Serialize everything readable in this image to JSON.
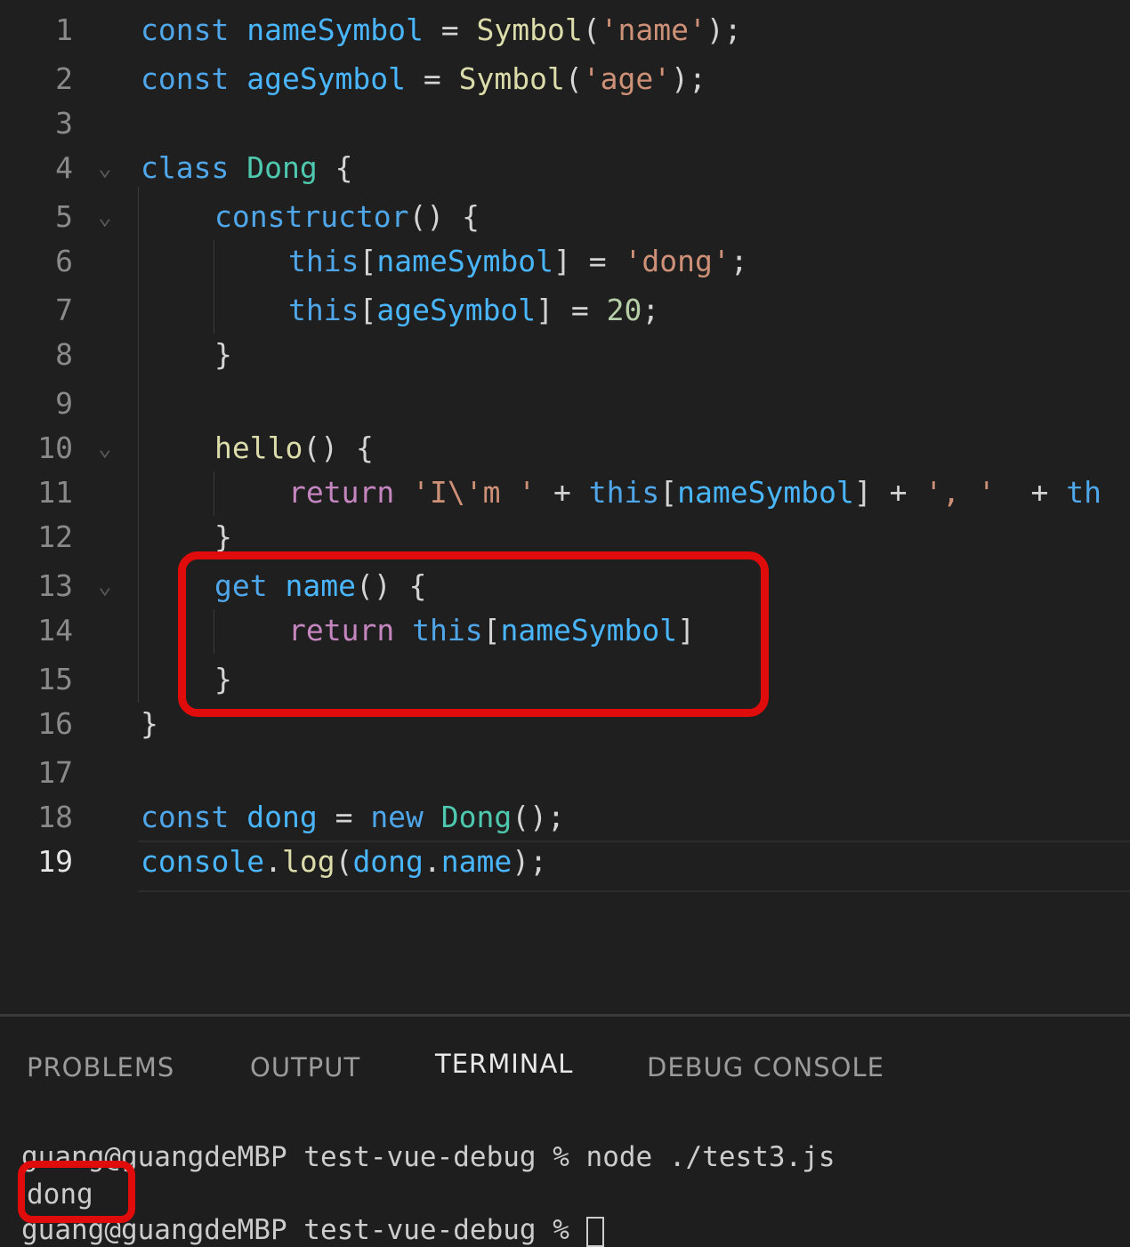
{
  "editor": {
    "lines": [
      {
        "n": "1",
        "indent": 0,
        "tokens": [
          [
            "k",
            "const"
          ],
          [
            "p",
            " "
          ],
          [
            "v",
            "nameSymbol"
          ],
          [
            "p",
            " = "
          ],
          [
            "f",
            "Symbol"
          ],
          [
            "p",
            "("
          ],
          [
            "s",
            "'name'"
          ],
          [
            "p",
            ");"
          ]
        ]
      },
      {
        "n": "2",
        "indent": 0,
        "tokens": [
          [
            "k",
            "const"
          ],
          [
            "p",
            " "
          ],
          [
            "v",
            "ageSymbol"
          ],
          [
            "p",
            " = "
          ],
          [
            "f",
            "Symbol"
          ],
          [
            "p",
            "("
          ],
          [
            "s",
            "'age'"
          ],
          [
            "p",
            ");"
          ]
        ]
      },
      {
        "n": "3",
        "indent": 0,
        "tokens": []
      },
      {
        "n": "4",
        "indent": 0,
        "fold": true,
        "tokens": [
          [
            "k",
            "class"
          ],
          [
            "p",
            " "
          ],
          [
            "c",
            "Dong"
          ],
          [
            "p",
            " {"
          ]
        ]
      },
      {
        "n": "5",
        "indent": 1,
        "fold": true,
        "tokens": [
          [
            "k",
            "constructor"
          ],
          [
            "p",
            "() {"
          ]
        ]
      },
      {
        "n": "6",
        "indent": 2,
        "tokens": [
          [
            "k",
            "this"
          ],
          [
            "p",
            "["
          ],
          [
            "v",
            "nameSymbol"
          ],
          [
            "p",
            "] = "
          ],
          [
            "s",
            "'dong'"
          ],
          [
            "p",
            ";"
          ]
        ]
      },
      {
        "n": "7",
        "indent": 2,
        "tokens": [
          [
            "k",
            "this"
          ],
          [
            "p",
            "["
          ],
          [
            "v",
            "ageSymbol"
          ],
          [
            "p",
            "] = "
          ],
          [
            "n",
            "20"
          ],
          [
            "p",
            ";"
          ]
        ]
      },
      {
        "n": "8",
        "indent": 1,
        "tokens": [
          [
            "p",
            "}"
          ]
        ]
      },
      {
        "n": "9",
        "indent": 0,
        "tokens": []
      },
      {
        "n": "10",
        "indent": 1,
        "fold": true,
        "tokens": [
          [
            "f",
            "hello"
          ],
          [
            "p",
            "() {"
          ]
        ]
      },
      {
        "n": "11",
        "indent": 2,
        "tokens": [
          [
            "r",
            "return"
          ],
          [
            "p",
            " "
          ],
          [
            "s",
            "'I\\'m '"
          ],
          [
            "p",
            " + "
          ],
          [
            "k",
            "this"
          ],
          [
            "p",
            "["
          ],
          [
            "v",
            "nameSymbol"
          ],
          [
            "p",
            "] + "
          ],
          [
            "s",
            "', '"
          ],
          [
            "p",
            "  + "
          ],
          [
            "k",
            "th"
          ]
        ]
      },
      {
        "n": "12",
        "indent": 1,
        "tokens": [
          [
            "p",
            "}"
          ]
        ]
      },
      {
        "n": "13",
        "indent": 1,
        "fold": true,
        "tokens": [
          [
            "k",
            "get"
          ],
          [
            "p",
            " "
          ],
          [
            "v",
            "name"
          ],
          [
            "p",
            "() {"
          ]
        ]
      },
      {
        "n": "14",
        "indent": 2,
        "tokens": [
          [
            "r",
            "return"
          ],
          [
            "p",
            " "
          ],
          [
            "k",
            "this"
          ],
          [
            "p",
            "["
          ],
          [
            "v",
            "nameSymbol"
          ],
          [
            "p",
            "]"
          ]
        ]
      },
      {
        "n": "15",
        "indent": 1,
        "tokens": [
          [
            "p",
            "}"
          ]
        ]
      },
      {
        "n": "16",
        "indent": 0,
        "tokens": [
          [
            "p",
            "}"
          ]
        ]
      },
      {
        "n": "17",
        "indent": 0,
        "tokens": []
      },
      {
        "n": "18",
        "indent": 0,
        "tokens": [
          [
            "k",
            "const"
          ],
          [
            "p",
            " "
          ],
          [
            "v",
            "dong"
          ],
          [
            "p",
            " = "
          ],
          [
            "k",
            "new"
          ],
          [
            "p",
            " "
          ],
          [
            "c",
            "Dong"
          ],
          [
            "p",
            "();"
          ]
        ]
      },
      {
        "n": "19",
        "indent": 0,
        "active": true,
        "tokens": [
          [
            "v",
            "console"
          ],
          [
            "p",
            "."
          ],
          [
            "f",
            "log"
          ],
          [
            "p",
            "("
          ],
          [
            "v",
            "dong"
          ],
          [
            "p",
            "."
          ],
          [
            "v",
            "name"
          ],
          [
            "p",
            ");"
          ]
        ]
      }
    ]
  },
  "panel": {
    "tabs": [
      "PROBLEMS",
      "OUTPUT",
      "TERMINAL",
      "DEBUG CONSOLE"
    ],
    "active_tab": "TERMINAL",
    "terminal": {
      "line1": "guang@guangdeMBP test-vue-debug % node ./test3.js",
      "line2": "dong",
      "line3": "guang@guangdeMBP test-vue-debug % "
    }
  },
  "colors": {
    "highlight": "#e00b0b",
    "background": "#1f1f1f"
  }
}
